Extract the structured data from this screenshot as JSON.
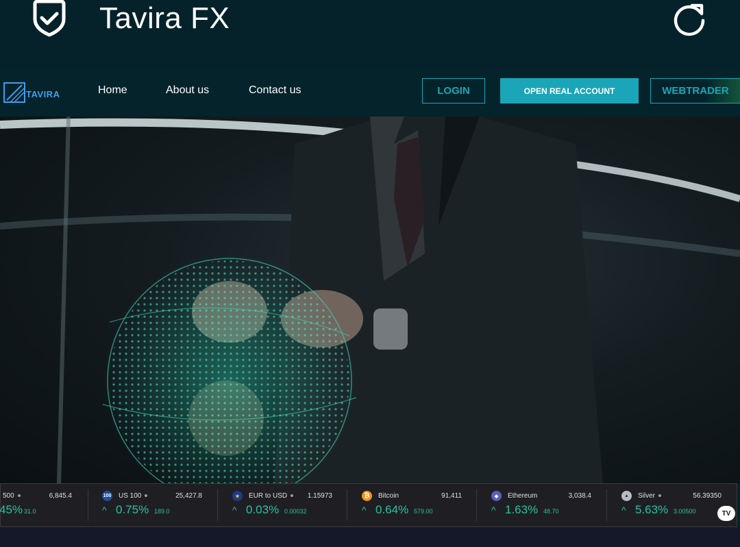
{
  "app": {
    "title": "Tavira FX"
  },
  "nav": {
    "logo_text": "TAVIRA",
    "links": [
      "Home",
      "About us",
      "Contact us"
    ],
    "login_label": "LOGIN",
    "open_account_label": "OPEN REAL ACCOUNT",
    "webtrader_label": "WEBTRADER"
  },
  "colors": {
    "accent": "#1aa6b8",
    "background": "#05222a",
    "positive": "#27c2a0"
  },
  "ticker": [
    {
      "name": "500",
      "price": "6,845.4",
      "pct": "45%",
      "change": "31.0",
      "icon": ""
    },
    {
      "name": "US 100",
      "price": "25,427.8",
      "pct": "0.75%",
      "change": "189.0",
      "icon": "100"
    },
    {
      "name": "EUR to USD",
      "price": "1.15973",
      "pct": "0.03%",
      "change": "0.00032",
      "icon": "eu-flag-icon"
    },
    {
      "name": "Bitcoin",
      "price": "91,411",
      "pct": "0.64%",
      "change": "579.00",
      "icon": "₿"
    },
    {
      "name": "Ethereum",
      "price": "3,038.4",
      "pct": "1.63%",
      "change": "48.70",
      "icon": "ethereum-icon"
    },
    {
      "name": "Silver",
      "price": "56.39350",
      "pct": "5.63%",
      "change": "3.00500",
      "icon": "silver-icon"
    }
  ],
  "tv_badge": "TV"
}
